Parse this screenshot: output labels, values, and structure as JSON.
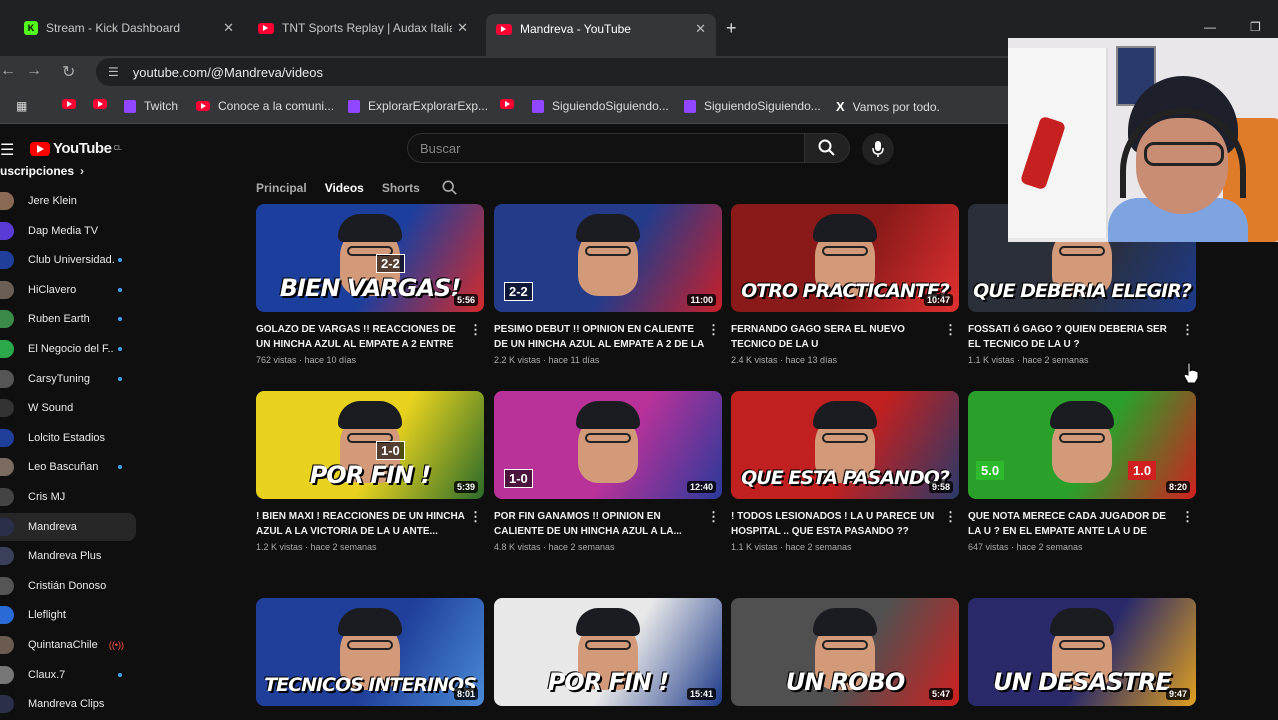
{
  "browser": {
    "tabs": [
      {
        "label": "Stream - Kick Dashboard",
        "icon": "kick-icon",
        "active": false
      },
      {
        "label": "TNT Sports Replay | Audax Italia",
        "icon": "youtube-icon",
        "active": false
      },
      {
        "label": "Mandreva - YouTube",
        "icon": "youtube-icon",
        "active": true
      }
    ],
    "new_tab_symbol": "+",
    "url": "youtube.com/@Mandreva/videos",
    "bookmarks": [
      {
        "label": "",
        "icon": "youtube-icon"
      },
      {
        "label": "",
        "icon": "youtube-icon"
      },
      {
        "label": "Twitch",
        "icon": "twitch-icon"
      },
      {
        "label": "Conoce a la comuni...",
        "icon": "youtube-icon"
      },
      {
        "label": "ExplorarExplorarExp...",
        "icon": "twitch-icon"
      },
      {
        "label": "",
        "icon": "youtube-icon"
      },
      {
        "label": "SiguiendoSiguiendo...",
        "icon": "twitch-icon"
      },
      {
        "label": "SiguiendoSiguiendo...",
        "icon": "twitch-icon"
      },
      {
        "label": "Vamos por todo.",
        "icon": "x-icon"
      }
    ]
  },
  "youtube": {
    "logo_text": "YouTube",
    "logo_sup": "CL",
    "search_placeholder": "Buscar",
    "channel_tabs": [
      {
        "label": "Principal",
        "active": false
      },
      {
        "label": "Videos",
        "active": true
      },
      {
        "label": "Shorts",
        "active": false
      }
    ]
  },
  "sidebar": {
    "title": "Suscripciones",
    "items": [
      {
        "name": "Jere Klein",
        "color": "#8a6a55",
        "badge": ""
      },
      {
        "name": "Dap Media TV",
        "color": "#5b3bd6",
        "badge": ""
      },
      {
        "name": "Club Universidad...",
        "color": "#1f3f9a",
        "badge": "dot"
      },
      {
        "name": "HiClavero",
        "color": "#6b5f55",
        "badge": "dot"
      },
      {
        "name": "Ruben Earth",
        "color": "#3b8a4a",
        "badge": "dot"
      },
      {
        "name": "El Negocio del F...",
        "color": "#2aa84a",
        "badge": "dot"
      },
      {
        "name": "CarsyTuning",
        "color": "#555555",
        "badge": "dot"
      },
      {
        "name": "W Sound",
        "color": "#333333",
        "badge": ""
      },
      {
        "name": "Lolcito Estadios",
        "color": "#1f3f9a",
        "badge": ""
      },
      {
        "name": "Leo Bascuñan",
        "color": "#7a6a60",
        "badge": "dot"
      },
      {
        "name": "Cris MJ",
        "color": "#444444",
        "badge": ""
      },
      {
        "name": "Mandreva",
        "color": "#2b2f4a",
        "badge": "",
        "active": true
      },
      {
        "name": "Mandreva Plus",
        "color": "#3a3f5a",
        "badge": ""
      },
      {
        "name": "Cristián Donoso",
        "color": "#555555",
        "badge": ""
      },
      {
        "name": "Lleflight",
        "color": "#2a6ad6",
        "badge": ""
      },
      {
        "name": "QuintanaChile",
        "color": "#6a5a50",
        "badge": "live"
      },
      {
        "name": "Claux.7",
        "color": "#777777",
        "badge": "dot"
      },
      {
        "name": "Mandreva Clips",
        "color": "#2b2f4a",
        "badge": ""
      }
    ]
  },
  "videos": [
    {
      "thumb_text": "BIEN VARGAS!",
      "score": "2-2",
      "duration": "5:56",
      "title": "GOLAZO DE VARGAS !! REACCIONES DE UN HINCHA AZUL AL EMPATE A 2 ENTRE LA U...",
      "meta": "762 vistas · hace 10 días",
      "bg": "#1c3f9e",
      "accent": "#d42b2b"
    },
    {
      "thumb_text": "",
      "score": "2-2",
      "duration": "11:00",
      "title": "PESIMO DEBUT !! OPINION EN CALIENTE DE UN HINCHA AZUL AL EMPATE A 2 DE LA U...",
      "meta": "2.2 K vistas · hace 11 días",
      "bg": "#243b8a",
      "accent": "#c9202a"
    },
    {
      "thumb_text": "OTRO PRACTICANTE?",
      "score": "",
      "duration": "10:47",
      "title": "FERNANDO GAGO SERA EL NUEVO TECNICO DE LA U",
      "meta": "2.4 K vistas · hace 13 días",
      "bg": "#8a1a1a",
      "accent": "#e03030"
    },
    {
      "thumb_text": "QUE DEBERIA ELEGIR?",
      "score": "",
      "duration": "",
      "title": "FOSSATI ó GAGO ? QUIEN DEBERIA SER EL TECNICO DE LA U ?",
      "meta": "1.1 K vistas · hace 2 semanas",
      "bg": "#2a2f3a",
      "accent": "#1d3a8a"
    },
    {
      "thumb_text": "POR FIN !",
      "score": "1-0",
      "duration": "5:39",
      "title": "! BIEN MAXI ! REACCIONES DE UN HINCHA AZUL A LA VICTORIA DE LA U ANTE...",
      "meta": "1.2 K vistas · hace 2 semanas",
      "bg": "#e8d21e",
      "accent": "#2a6a2a"
    },
    {
      "thumb_text": "",
      "score": "1-0",
      "duration": "12:40",
      "title": "POR FIN GANAMOS !! OPINION EN CALIENTE DE UN HINCHA AZUL A LA...",
      "meta": "4.8 K vistas · hace 2 semanas",
      "bg": "#b8329a",
      "accent": "#2a3a9a"
    },
    {
      "thumb_text": "QUE ESTA PASANDO?",
      "score": "",
      "duration": "9:58",
      "title": "! TODOS LESIONADOS ! LA U PARECE UN HOSPITAL .. QUE ESTA PASANDO ??",
      "meta": "1.1 K vistas · hace 2 semanas",
      "bg": "#c02020",
      "accent": "#2a3a6a"
    },
    {
      "thumb_text": "",
      "score": "",
      "duration": "8:20",
      "title": "QUE NOTA MERECE CADA JUGADOR DE LA U ? EN EL EMPATE ANTE LA U DE CONCE ?...",
      "meta": "647 vistas · hace 2 semanas",
      "bg": "#2aa02a",
      "accent": "#d02020"
    },
    {
      "thumb_text": "TECNICOS INTERINOS",
      "score": "",
      "duration": "8:01",
      "title": "",
      "meta": "",
      "bg": "#1f3f9a",
      "accent": "#4a8ad6"
    },
    {
      "thumb_text": "POR FIN !",
      "score": "",
      "duration": "15:41",
      "title": "",
      "meta": "",
      "bg": "#e8e8e8",
      "accent": "#1d3a8a"
    },
    {
      "thumb_text": "UN ROBO",
      "score": "",
      "duration": "5:47",
      "title": "",
      "meta": "",
      "bg": "#505050",
      "accent": "#d02020"
    },
    {
      "thumb_text": "UN DESASTRE",
      "score": "",
      "duration": "9:47",
      "title": "",
      "meta": "",
      "bg": "#2a2a6a",
      "accent": "#e0a020"
    }
  ],
  "extra_labels": {
    "rating_good": "5.0",
    "rating_bad": "1.0"
  }
}
